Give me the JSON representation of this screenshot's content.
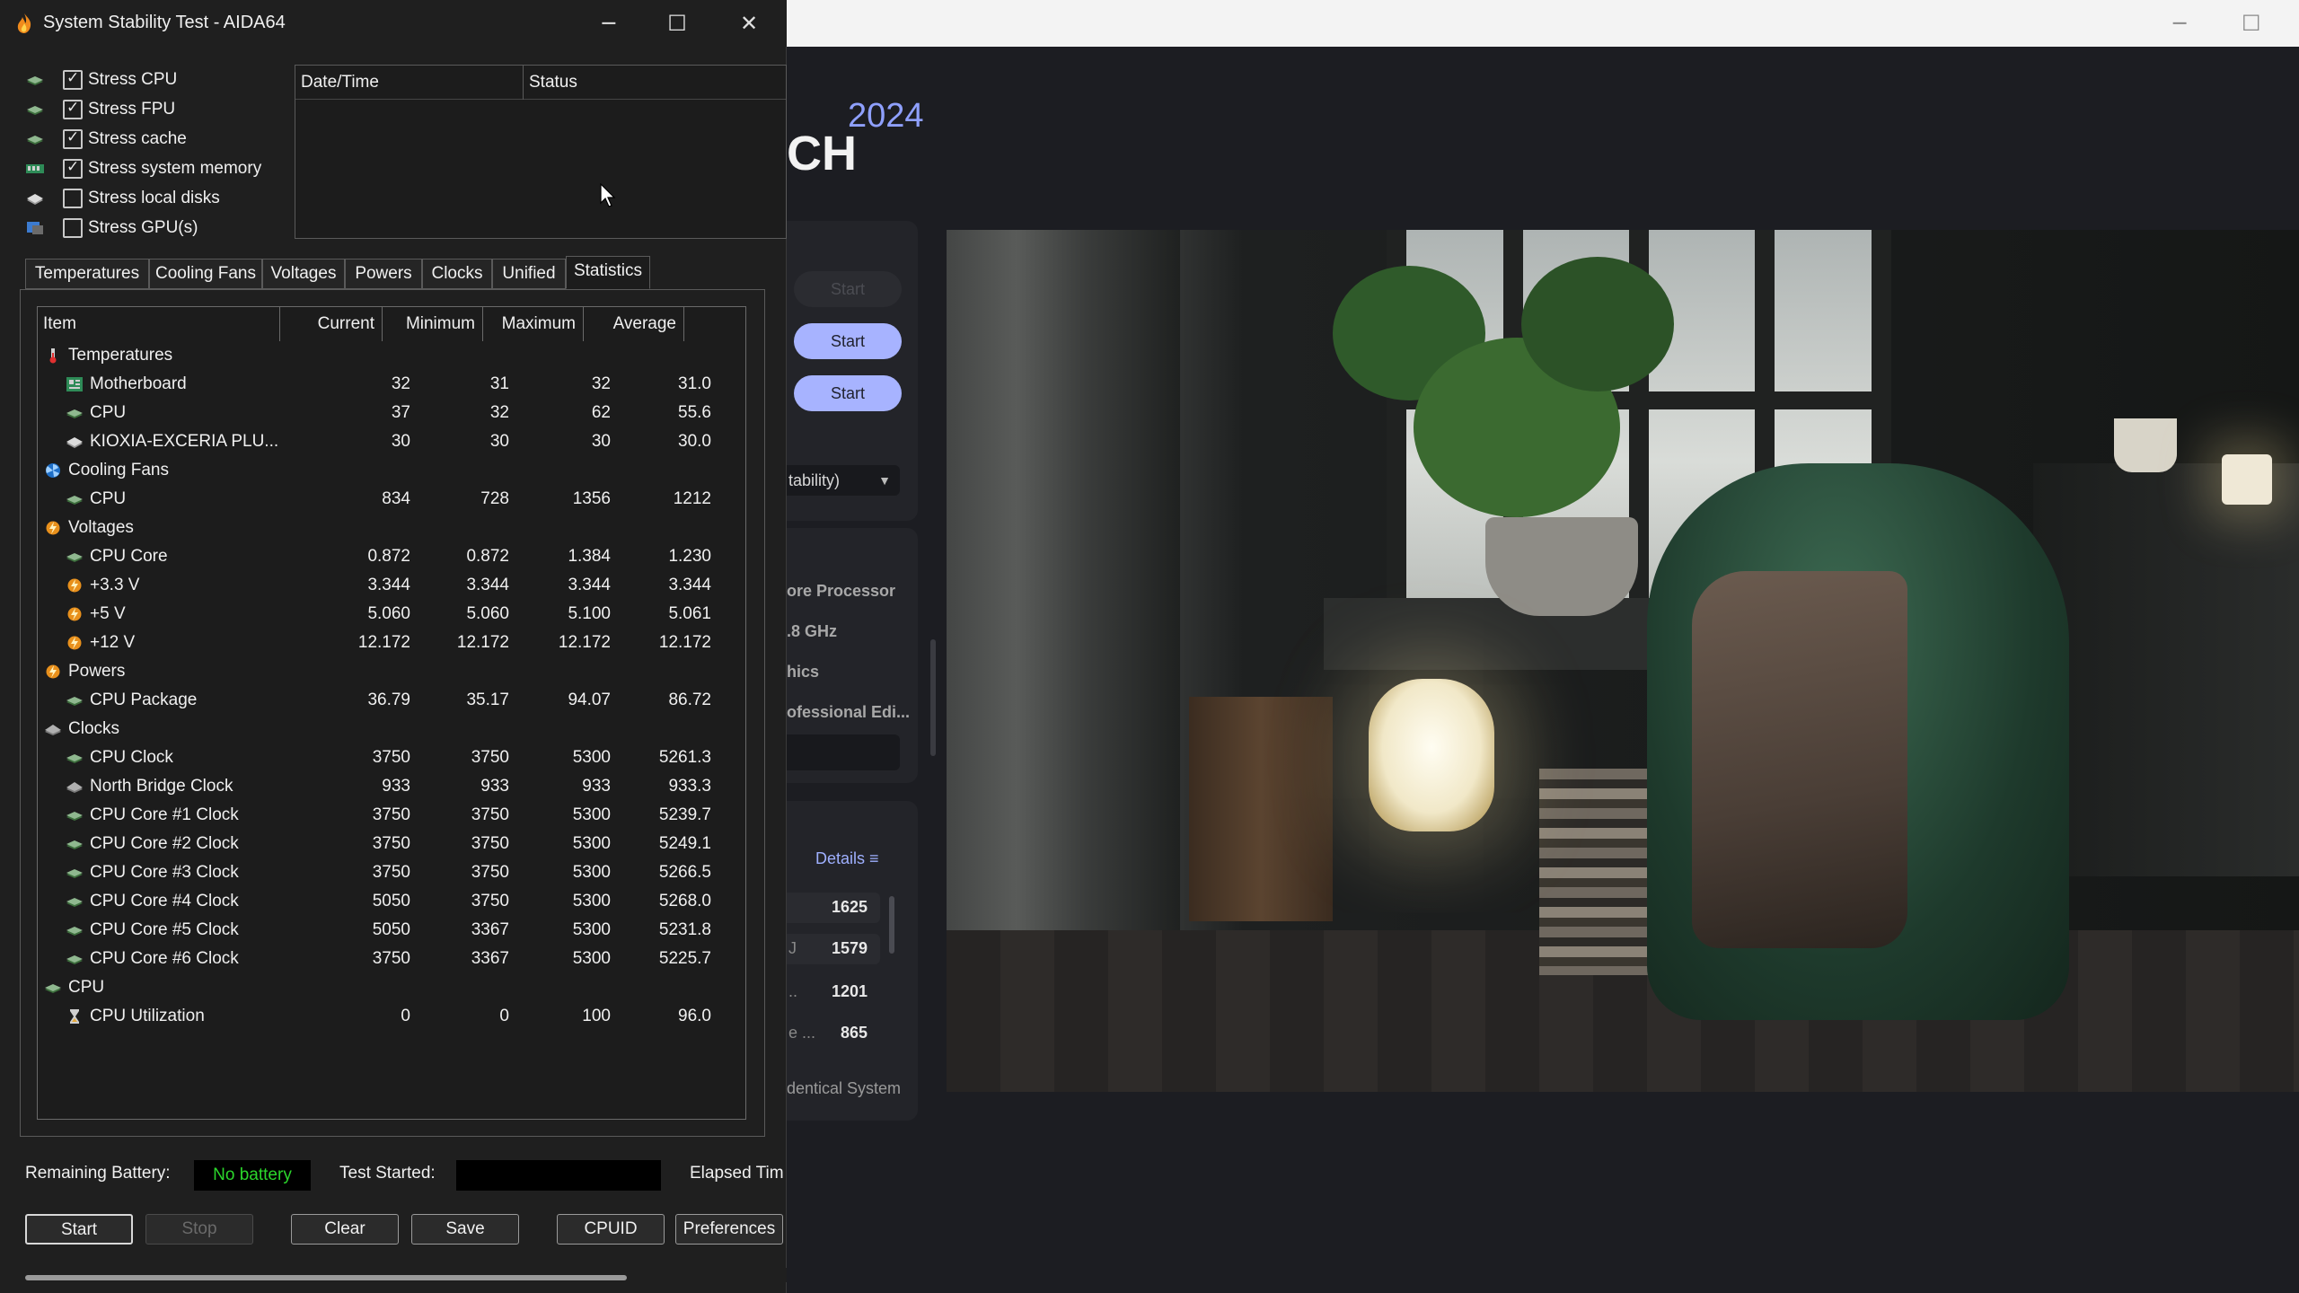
{
  "window": {
    "title": "System Stability Test - AIDA64",
    "minimize": "─",
    "maximize": "☐",
    "close": "✕"
  },
  "stress_options": [
    {
      "label": "Stress CPU",
      "checked": true,
      "icon": "cpu-chip-icon"
    },
    {
      "label": "Stress FPU",
      "checked": true,
      "icon": "fpu-chip-icon"
    },
    {
      "label": "Stress cache",
      "checked": true,
      "icon": "cache-chip-icon"
    },
    {
      "label": "Stress system memory",
      "checked": true,
      "icon": "memory-module-icon"
    },
    {
      "label": "Stress local disks",
      "checked": false,
      "icon": "disk-drive-icon"
    },
    {
      "label": "Stress GPU(s)",
      "checked": false,
      "icon": "gpu-card-icon"
    }
  ],
  "log": {
    "col_datetime": "Date/Time",
    "col_status": "Status"
  },
  "tabs": [
    "Temperatures",
    "Cooling Fans",
    "Voltages",
    "Powers",
    "Clocks",
    "Unified",
    "Statistics"
  ],
  "active_tab": "Statistics",
  "grid": {
    "headers": {
      "item": "Item",
      "current": "Current",
      "minimum": "Minimum",
      "maximum": "Maximum",
      "average": "Average"
    },
    "rows": [
      {
        "kind": "group",
        "name": "Temperatures",
        "icon": "thermometer-icon"
      },
      {
        "kind": "item",
        "name": "Motherboard",
        "icon": "motherboard-icon",
        "current": "32",
        "minimum": "31",
        "maximum": "32",
        "average": "31.0"
      },
      {
        "kind": "item",
        "name": "CPU",
        "icon": "cpu-chip-icon",
        "current": "37",
        "minimum": "32",
        "maximum": "62",
        "average": "55.6"
      },
      {
        "kind": "item",
        "name": "KIOXIA-EXCERIA PLU...",
        "icon": "disk-drive-icon",
        "current": "30",
        "minimum": "30",
        "maximum": "30",
        "average": "30.0"
      },
      {
        "kind": "group",
        "name": "Cooling Fans",
        "icon": "fan-icon"
      },
      {
        "kind": "item",
        "name": "CPU",
        "icon": "cpu-chip-icon",
        "current": "834",
        "minimum": "728",
        "maximum": "1356",
        "average": "1212"
      },
      {
        "kind": "group",
        "name": "Voltages",
        "icon": "voltage-icon"
      },
      {
        "kind": "item",
        "name": "CPU Core",
        "icon": "cpu-chip-icon",
        "current": "0.872",
        "minimum": "0.872",
        "maximum": "1.384",
        "average": "1.230"
      },
      {
        "kind": "item",
        "name": "+3.3 V",
        "icon": "voltage-icon",
        "current": "3.344",
        "minimum": "3.344",
        "maximum": "3.344",
        "average": "3.344"
      },
      {
        "kind": "item",
        "name": "+5 V",
        "icon": "voltage-icon",
        "current": "5.060",
        "minimum": "5.060",
        "maximum": "5.100",
        "average": "5.061"
      },
      {
        "kind": "item",
        "name": "+12 V",
        "icon": "voltage-icon",
        "current": "12.172",
        "minimum": "12.172",
        "maximum": "12.172",
        "average": "12.172"
      },
      {
        "kind": "group",
        "name": "Powers",
        "icon": "power-icon"
      },
      {
        "kind": "item",
        "name": "CPU Package",
        "icon": "cpu-chip-icon",
        "current": "36.79",
        "minimum": "35.17",
        "maximum": "94.07",
        "average": "86.72"
      },
      {
        "kind": "group",
        "name": "Clocks",
        "icon": "clock-chip-icon"
      },
      {
        "kind": "item",
        "name": "CPU Clock",
        "icon": "cpu-chip-icon",
        "current": "3750",
        "minimum": "3750",
        "maximum": "5300",
        "average": "5261.3"
      },
      {
        "kind": "item",
        "name": "North Bridge Clock",
        "icon": "chipset-icon",
        "current": "933",
        "minimum": "933",
        "maximum": "933",
        "average": "933.3"
      },
      {
        "kind": "item",
        "name": "CPU Core #1 Clock",
        "icon": "cpu-chip-icon",
        "current": "3750",
        "minimum": "3750",
        "maximum": "5300",
        "average": "5239.7"
      },
      {
        "kind": "item",
        "name": "CPU Core #2 Clock",
        "icon": "cpu-chip-icon",
        "current": "3750",
        "minimum": "3750",
        "maximum": "5300",
        "average": "5249.1"
      },
      {
        "kind": "item",
        "name": "CPU Core #3 Clock",
        "icon": "cpu-chip-icon",
        "current": "3750",
        "minimum": "3750",
        "maximum": "5300",
        "average": "5266.5"
      },
      {
        "kind": "item",
        "name": "CPU Core #4 Clock",
        "icon": "cpu-chip-icon",
        "current": "5050",
        "minimum": "3750",
        "maximum": "5300",
        "average": "5268.0"
      },
      {
        "kind": "item",
        "name": "CPU Core #5 Clock",
        "icon": "cpu-chip-icon",
        "current": "5050",
        "minimum": "3367",
        "maximum": "5300",
        "average": "5231.8"
      },
      {
        "kind": "item",
        "name": "CPU Core #6 Clock",
        "icon": "cpu-chip-icon",
        "current": "3750",
        "minimum": "3367",
        "maximum": "5300",
        "average": "5225.7"
      },
      {
        "kind": "group",
        "name": "CPU",
        "icon": "cpu-chip-icon"
      },
      {
        "kind": "item",
        "name": "CPU Utilization",
        "icon": "hourglass-icon",
        "current": "0",
        "minimum": "0",
        "maximum": "100",
        "average": "96.0"
      }
    ]
  },
  "footer": {
    "battery_label": "Remaining Battery:",
    "battery_value": "No battery",
    "test_started_label": "Test Started:",
    "test_started_value": "",
    "elapsed_label": "Elapsed Tim"
  },
  "buttons": {
    "start": "Start",
    "stop": "Stop",
    "clear": "Clear",
    "save": "Save",
    "cpuid": "CPUID",
    "preferences": "Preferences"
  },
  "background_app": {
    "year": "2024",
    "title_fragment": "CH",
    "start_buttons": [
      "Start",
      "Start",
      "Start"
    ],
    "dropdown_text": "tability)",
    "specs": [
      "ore Processor",
      ".8 GHz",
      "hics",
      "ofessional Edi..."
    ],
    "details_label": "Details",
    "ranking": [
      {
        "prefix": "",
        "value": "1625"
      },
      {
        "prefix": "J",
        "value": "1579"
      },
      {
        "prefix": "..",
        "value": "1201"
      },
      {
        "prefix": "e ...",
        "value": "865"
      }
    ],
    "identical_label": "dentical System"
  },
  "colors": {
    "battery_text": "#2bd62b",
    "accent_button": "#a7b3ff",
    "year_text": "#8fa0ff",
    "window_bg": "#1f1f1f"
  }
}
